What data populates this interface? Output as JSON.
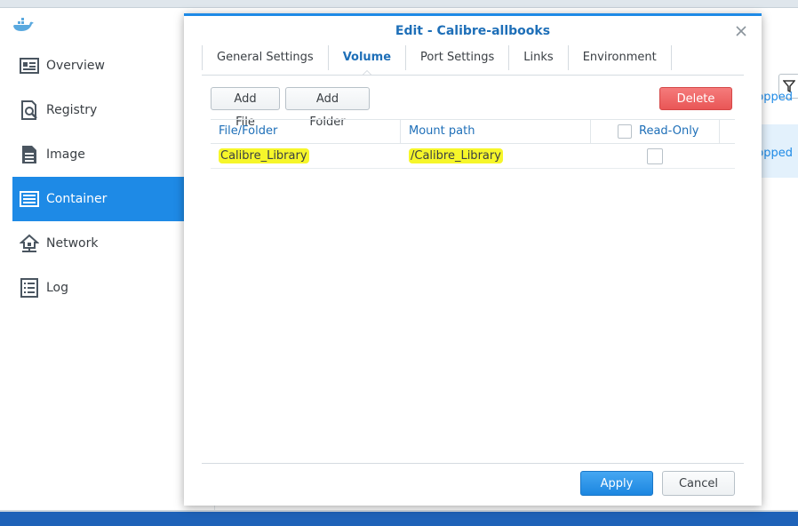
{
  "sidebar": {
    "items": [
      {
        "label": "Overview",
        "icon": "overview-icon"
      },
      {
        "label": "Registry",
        "icon": "registry-icon"
      },
      {
        "label": "Image",
        "icon": "image-icon"
      },
      {
        "label": "Container",
        "icon": "container-icon",
        "active": true
      },
      {
        "label": "Network",
        "icon": "network-icon"
      },
      {
        "label": "Log",
        "icon": "log-icon"
      }
    ]
  },
  "background_list": {
    "status_1": "opped",
    "status_2": "opped"
  },
  "dialog": {
    "title": "Edit - Calibre-allbooks",
    "tabs": [
      {
        "label": "General Settings"
      },
      {
        "label": "Volume",
        "active": true
      },
      {
        "label": "Port Settings"
      },
      {
        "label": "Links"
      },
      {
        "label": "Environment"
      }
    ],
    "toolbar": {
      "add_file": "Add File",
      "add_folder": "Add Folder",
      "delete": "Delete"
    },
    "grid": {
      "columns": [
        "File/Folder",
        "Mount path",
        "Read-Only"
      ],
      "rows": [
        {
          "file_folder": "Calibre_Library",
          "mount_path": "/Calibre_Library",
          "read_only": false
        }
      ]
    },
    "footer": {
      "apply": "Apply",
      "cancel": "Cancel"
    }
  },
  "colors": {
    "accent": "#1e8ae6",
    "highlight": "#f6f62a",
    "delete": "#e95656"
  }
}
